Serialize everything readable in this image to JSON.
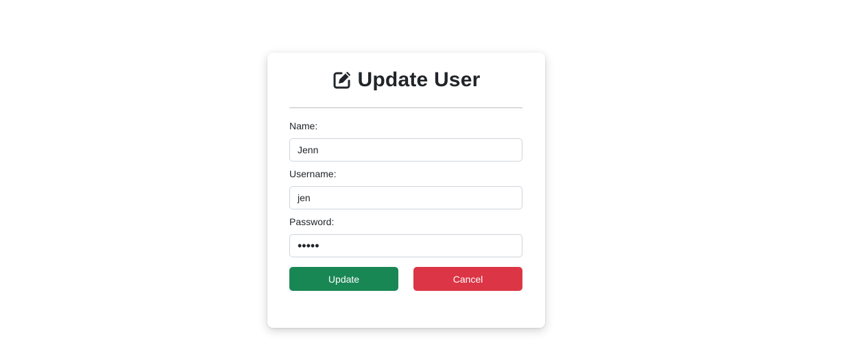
{
  "form": {
    "title": "Update User",
    "title_icon": "edit-icon",
    "fields": {
      "name": {
        "label": "Name:",
        "value": "Jenn"
      },
      "username": {
        "label": "Username:",
        "value": "jen"
      },
      "password": {
        "label": "Password:",
        "value": "•••••"
      }
    },
    "buttons": {
      "update_label": "Update",
      "cancel_label": "Cancel"
    }
  },
  "colors": {
    "update": "#198754",
    "cancel": "#dc3545",
    "text": "#212529"
  }
}
